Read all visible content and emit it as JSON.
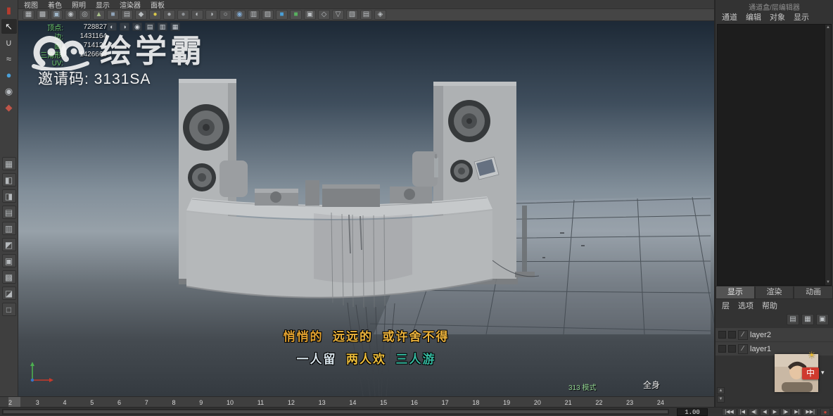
{
  "colors": {
    "hud_label_green": "#6ecb6e",
    "subtitle_orange": "#eab236",
    "subtitle_teal": "#35b89f",
    "subtitle_pale": "#d8e4ec",
    "ime_badge_bg": "#cf3a2e",
    "viewport_gradient_top": "#1d2936",
    "viewport_gradient_mid": "#97a1a9"
  },
  "viewport_menu": [
    "视图",
    "着色",
    "照明",
    "显示",
    "渲染器",
    "面板"
  ],
  "toolbar_icons": [
    {
      "g": "▦",
      "c": "#b9bdc0"
    },
    {
      "g": "▩",
      "c": "#b9bdc0"
    },
    {
      "g": "▣",
      "c": "#9fb6c9"
    },
    {
      "g": "◉",
      "c": "#b9bdc0"
    },
    {
      "g": "◎",
      "c": "#b9bdc0"
    },
    {
      "g": "▲",
      "c": "#a8c08a"
    },
    {
      "g": "■",
      "c": "#8fa3b8"
    },
    {
      "g": "▤",
      "c": "#b9bdc0"
    },
    {
      "g": "◆",
      "c": "#b9bdc0"
    },
    {
      "g": "●",
      "c": "#d9c84a"
    },
    {
      "g": "●",
      "c": "#a9adb1"
    },
    {
      "g": "●",
      "c": "#8e9296"
    },
    {
      "g": "◐",
      "c": "#b9bdc0"
    },
    {
      "g": "◑",
      "c": "#b9bdc0"
    },
    {
      "g": "○",
      "c": "#b9bdc0"
    },
    {
      "g": "◉",
      "c": "#7fa8d0"
    },
    {
      "g": "▥",
      "c": "#b9bdc0"
    },
    {
      "g": "▨",
      "c": "#b9bdc0"
    },
    {
      "g": "■",
      "c": "#4aa0d8"
    },
    {
      "g": "■",
      "c": "#58b060"
    },
    {
      "g": "▣",
      "c": "#b9bdc0"
    },
    {
      "g": "◇",
      "c": "#b9bdc0"
    },
    {
      "g": "▽",
      "c": "#b9bdc0"
    },
    {
      "g": "▧",
      "c": "#b9bdc0"
    },
    {
      "g": "▤",
      "c": "#b9bdc0"
    },
    {
      "g": "◈",
      "c": "#b9bdc0"
    }
  ],
  "overlay_icons": [
    {
      "g": "◐"
    },
    {
      "g": "◑"
    },
    {
      "g": "◉"
    },
    {
      "g": "▤"
    },
    {
      "g": "▥"
    },
    {
      "g": "▦"
    }
  ],
  "left_tools": [
    {
      "g": "▮",
      "c": "#b63c2e",
      "bg": "transparent"
    },
    {
      "g": "↖",
      "c": "#ececec",
      "bg": "#2a2a2a"
    },
    {
      "g": "∪",
      "c": "#c8c8c8",
      "bg": "transparent"
    },
    {
      "g": "≈",
      "c": "#c8c8c8",
      "bg": "transparent"
    },
    {
      "g": "●",
      "c": "#4a9fd8",
      "bg": "transparent"
    },
    {
      "g": "◉",
      "c": "#b8bcc0",
      "bg": "transparent"
    },
    {
      "g": "◆",
      "c": "#c05548",
      "bg": "transparent"
    }
  ],
  "layout_buttons": [
    {
      "g": "▦"
    },
    {
      "g": "◧"
    },
    {
      "g": "◨"
    },
    {
      "g": "▤"
    },
    {
      "g": "▥"
    },
    {
      "g": "◩"
    },
    {
      "g": "▣"
    },
    {
      "g": "▩"
    },
    {
      "g": "◪"
    },
    {
      "g": "□"
    }
  ],
  "hud": {
    "rows": [
      {
        "label": "顶点:",
        "value": "728827"
      },
      {
        "label": "边:",
        "value": "1431164"
      },
      {
        "label": "面:",
        "value": "714124"
      },
      {
        "label": "三角形:",
        "value": "1426668"
      },
      {
        "label": "UV:",
        "value": ""
      }
    ]
  },
  "watermark": {
    "brand": "绘学霸",
    "invite": "邀请码: 3131SA"
  },
  "subtitles": {
    "line1": [
      {
        "text": "悄悄的",
        "color": "#e2a12f"
      },
      {
        "text": "  远远的",
        "color": "#ecb33c"
      },
      {
        "text": "  或许舍不得",
        "color": "#ecb33c"
      }
    ],
    "line2": [
      {
        "text": "一人留",
        "color": "#d8e4ec"
      },
      {
        "text": "  两人欢",
        "color": "#edbd3a"
      },
      {
        "text": "  三人游",
        "color": "#35b89f"
      }
    ]
  },
  "viewport_labels": {
    "mode_text": "313 模式",
    "fullbody": "全身"
  },
  "right_panel": {
    "title": "通道盒/层编辑器",
    "top_menu": [
      "通道",
      "编辑",
      "对象",
      "显示"
    ],
    "editor_tabs": [
      "显示",
      "渲染",
      "动画"
    ],
    "layer_menu": [
      "层",
      "选项",
      "帮助"
    ],
    "layer_icons": [
      {
        "g": "▤"
      },
      {
        "g": "▦"
      },
      {
        "g": "▣"
      }
    ],
    "layers": [
      {
        "name": "layer2",
        "mark": "∕"
      },
      {
        "name": "layer1",
        "mark": "∕"
      }
    ],
    "ime_badge": "中",
    "ime_caret": "▾",
    "sun_icon": "☀",
    "scroll_up": "▲",
    "scroll_down": "▼"
  },
  "timeline": {
    "ticks": [
      "2",
      "3",
      "4",
      "5",
      "6",
      "7",
      "8",
      "9",
      "10",
      "11",
      "12",
      "13",
      "14",
      "15",
      "16",
      "17",
      "18",
      "19",
      "20",
      "21",
      "22",
      "23",
      "24"
    ]
  },
  "playback": {
    "frame": "1.00",
    "transport": [
      {
        "label": "|◀◀"
      },
      {
        "label": "|◀"
      },
      {
        "label": "◀|"
      },
      {
        "label": "◀"
      },
      {
        "label": "▶"
      },
      {
        "label": "|▶"
      },
      {
        "label": "▶|"
      },
      {
        "label": "▶▶|"
      }
    ],
    "autokey": "●"
  }
}
